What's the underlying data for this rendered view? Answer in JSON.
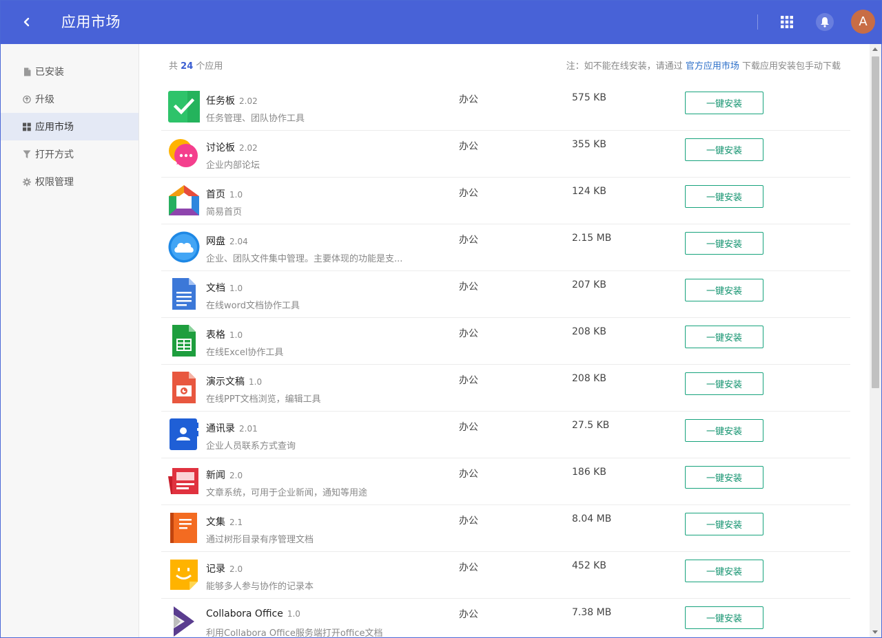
{
  "header": {
    "title": "应用市场",
    "avatar_letter": "A",
    "bg": "#4862d7"
  },
  "sidebar": {
    "items": [
      {
        "label": "已安装",
        "icon": "file-icon"
      },
      {
        "label": "升级",
        "icon": "upgrade-icon"
      },
      {
        "label": "应用市场",
        "icon": "grid-icon",
        "active": true
      },
      {
        "label": "打开方式",
        "icon": "filter-icon"
      },
      {
        "label": "权限管理",
        "icon": "gear-icon"
      }
    ]
  },
  "summary": {
    "prefix": "共",
    "count": "24",
    "suffix": "个应用"
  },
  "note": {
    "prefix": "注：如不能在线安装，请通过",
    "link": "官方应用市场",
    "suffix": "下载应用安装包手动下载"
  },
  "apps": [
    {
      "name": "任务板",
      "version": "2.02",
      "desc": "任务管理、团队协作工具",
      "category": "办公",
      "size": "575 KB",
      "button": "一键安装",
      "icon": "taskboard-icon"
    },
    {
      "name": "讨论板",
      "version": "2.02",
      "desc": "企业内部论坛",
      "category": "办公",
      "size": "355 KB",
      "button": "一键安装",
      "icon": "discussion-icon"
    },
    {
      "name": "首页",
      "version": "1.0",
      "desc": "简易首页",
      "category": "办公",
      "size": "124 KB",
      "button": "一键安装",
      "icon": "homepage-icon"
    },
    {
      "name": "网盘",
      "version": "2.04",
      "desc": "企业、团队文件集中管理。主要体现的功能是支...",
      "category": "办公",
      "size": "2.15 MB",
      "button": "一键安装",
      "icon": "cloud-drive-icon"
    },
    {
      "name": "文档",
      "version": "1.0",
      "desc": "在线word文档协作工具",
      "category": "办公",
      "size": "207 KB",
      "button": "一键安装",
      "icon": "document-icon"
    },
    {
      "name": "表格",
      "version": "1.0",
      "desc": "在线Excel协作工具",
      "category": "办公",
      "size": "208 KB",
      "button": "一键安装",
      "icon": "spreadsheet-icon"
    },
    {
      "name": "演示文稿",
      "version": "1.0",
      "desc": "在线PPT文档浏览，编辑工具",
      "category": "办公",
      "size": "208 KB",
      "button": "一键安装",
      "icon": "presentation-icon"
    },
    {
      "name": "通讯录",
      "version": "2.01",
      "desc": "企业人员联系方式查询",
      "category": "办公",
      "size": "27.5 KB",
      "button": "一键安装",
      "icon": "contacts-icon"
    },
    {
      "name": "新闻",
      "version": "2.0",
      "desc": "文章系统，可用于企业新闻，通知等用途",
      "category": "办公",
      "size": "186 KB",
      "button": "一键安装",
      "icon": "news-icon"
    },
    {
      "name": "文集",
      "version": "2.1",
      "desc": "通过树形目录有序管理文档",
      "category": "办公",
      "size": "8.04 MB",
      "button": "一键安装",
      "icon": "anthology-icon"
    },
    {
      "name": "记录",
      "version": "2.0",
      "desc": "能够多人参与协作的记录本",
      "category": "办公",
      "size": "452 KB",
      "button": "一键安装",
      "icon": "notes-icon"
    },
    {
      "name": "Collabora Office",
      "version": "1.0",
      "desc": "利用Collabora Office服务端打开office文档",
      "category": "办公",
      "size": "7.38 MB",
      "button": "一键安装",
      "icon": "collabora-icon"
    }
  ]
}
